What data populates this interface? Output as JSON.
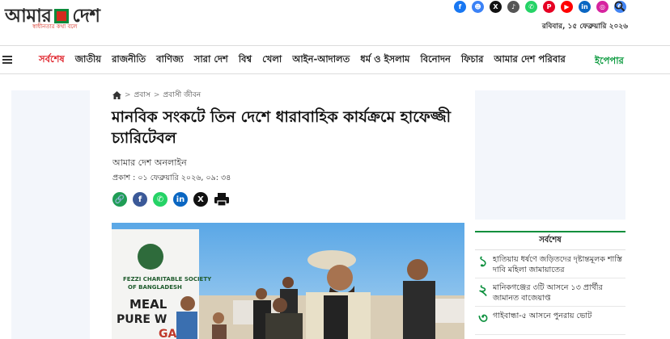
{
  "header": {
    "logo_word_left": "আমার",
    "logo_word_right": "দেশ",
    "logo_tagline": "স্বাধীনতার কথা বলে",
    "date": "রবিবার, ১৫ ফেব্রুয়ারি ২০২৬",
    "social": [
      {
        "icon": "facebook-icon",
        "glyph": "f",
        "color": "#1877f2"
      },
      {
        "icon": "community-icon",
        "glyph": "☻",
        "color": "#3b82f6"
      },
      {
        "icon": "x-icon",
        "glyph": "X",
        "color": "#111111"
      },
      {
        "icon": "tiktok-icon",
        "glyph": "♪",
        "color": "#555555"
      },
      {
        "icon": "whatsapp-icon",
        "glyph": "✆",
        "color": "#25d366"
      },
      {
        "icon": "pinterest-icon",
        "glyph": "P",
        "color": "#e60023"
      },
      {
        "icon": "youtube-icon",
        "glyph": "▶",
        "color": "#ff0000"
      },
      {
        "icon": "linkedin-icon",
        "glyph": "in",
        "color": "#0a66c2"
      },
      {
        "icon": "instagram-icon",
        "glyph": "◎",
        "color": "#d6249f"
      },
      {
        "icon": "google-news-icon",
        "glyph": "G",
        "color": "#4285f4"
      }
    ]
  },
  "nav": {
    "items": [
      "সর্বশেষ",
      "জাতীয়",
      "রাজনীতি",
      "বাণিজ্য",
      "সারা দেশ",
      "বিশ্ব",
      "খেলা",
      "আইন-আদালত",
      "ধর্ম ও ইসলাম",
      "বিনোদন",
      "ফিচার",
      "আমার দেশ পরিবার"
    ],
    "epaper": "ইপেপার",
    "active_color": "#e0242c",
    "epaper_color": "#0a9a3e"
  },
  "breadcrumb": {
    "section": "প্রবাস",
    "subsection": "প্রবাসী জীবন"
  },
  "article": {
    "title": "মানবিক সংকটে তিন দেশে ধারাবাহিক কার্যক্রমে হাফেজ্জী চ্যারিটেবল",
    "author": "আমার দেশ অনলাইন",
    "published": "প্রকাশ : ০১ ফেব্রুয়ারি ২০২৬, ০৯: ৩৪"
  },
  "share": [
    {
      "icon": "copy-link-icon",
      "glyph": "🔗",
      "color": "#1f9d55"
    },
    {
      "icon": "facebook-icon",
      "glyph": "f",
      "color": "#3b5998"
    },
    {
      "icon": "whatsapp-icon",
      "glyph": "✆",
      "color": "#25d366"
    },
    {
      "icon": "linkedin-icon",
      "glyph": "in",
      "color": "#0a66c2"
    },
    {
      "icon": "x-icon",
      "glyph": "X",
      "color": "#111111"
    },
    {
      "icon": "print-icon",
      "glyph": "",
      "color": "#111111"
    }
  ],
  "photo": {
    "banner_lines": [
      "FEZZI CHARITABLE SOCIETY",
      "OF BANGLADESH",
      "MEAL",
      "PURE W",
      "GA"
    ]
  },
  "latest": {
    "heading": "সর্বশেষ",
    "items": [
      {
        "num": "১",
        "text": "হাতিয়ায় ধর্ষণে জড়িতদের দৃষ্টান্তমূলক শাস্তি দাবি মহিলা জামায়াতের"
      },
      {
        "num": "২",
        "text": "মানিকগঞ্জের ৩টি আসনে ১৩ প্রার্থীর জামানত বাজেয়াপ্ত"
      },
      {
        "num": "৩",
        "text": "গাইবান্ধা-৫ আসনে পুনরায় ভোট"
      }
    ]
  }
}
